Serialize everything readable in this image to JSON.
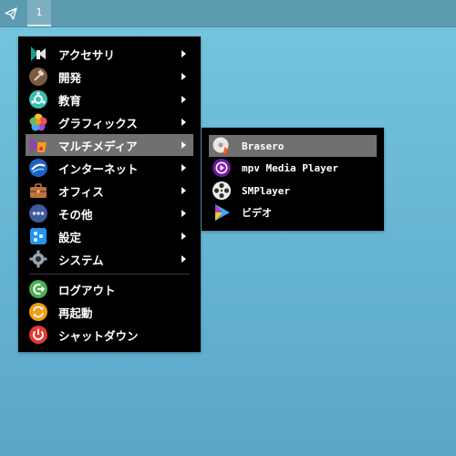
{
  "panel": {
    "workspace_label": "1"
  },
  "main_menu": {
    "items": [
      {
        "label": "アクセサリ",
        "icon": "accessories-icon",
        "submenu": true
      },
      {
        "label": "開発",
        "icon": "development-icon",
        "submenu": true
      },
      {
        "label": "教育",
        "icon": "education-icon",
        "submenu": true
      },
      {
        "label": "グラフィックス",
        "icon": "graphics-icon",
        "submenu": true
      },
      {
        "label": "マルチメディア",
        "icon": "multimedia-icon",
        "submenu": true,
        "highlighted": true
      },
      {
        "label": "インターネット",
        "icon": "internet-icon",
        "submenu": true
      },
      {
        "label": "オフィス",
        "icon": "office-icon",
        "submenu": true
      },
      {
        "label": "その他",
        "icon": "other-icon",
        "submenu": true
      },
      {
        "label": "設定",
        "icon": "settings-icon",
        "submenu": true
      },
      {
        "label": "システム",
        "icon": "system-icon",
        "submenu": true
      }
    ],
    "session_items": [
      {
        "label": "ログアウト",
        "icon": "logout-icon"
      },
      {
        "label": "再起動",
        "icon": "restart-icon"
      },
      {
        "label": "シャットダウン",
        "icon": "shutdown-icon"
      }
    ]
  },
  "sub_menu": {
    "items": [
      {
        "label": "Brasero",
        "icon": "brasero-icon",
        "highlighted": true
      },
      {
        "label": "mpv Media Player",
        "icon": "mpv-icon"
      },
      {
        "label": "SMPlayer",
        "icon": "smplayer-icon"
      },
      {
        "label": "ビデオ",
        "icon": "video-icon"
      }
    ]
  },
  "colors": {
    "desktop": "#6cbcd9",
    "panel": "#5c9bb0",
    "menu_bg": "#000000",
    "menu_highlight": "#707070",
    "menu_text": "#ffffff"
  }
}
